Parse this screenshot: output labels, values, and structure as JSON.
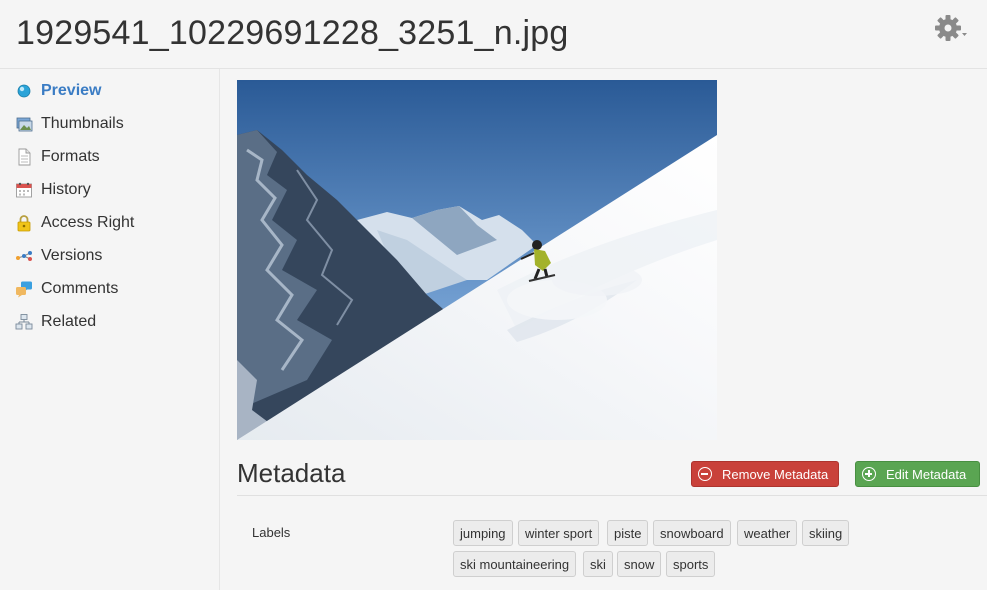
{
  "header": {
    "title": "1929541_10229691228_3251_n.jpg"
  },
  "sidebar": {
    "items": [
      {
        "label": "Preview",
        "icon": "preview-icon",
        "active": true
      },
      {
        "label": "Thumbnails",
        "icon": "thumbnails-icon"
      },
      {
        "label": "Formats",
        "icon": "formats-icon"
      },
      {
        "label": "History",
        "icon": "calendar-icon"
      },
      {
        "label": "Access Right",
        "icon": "lock-icon"
      },
      {
        "label": "Versions",
        "icon": "versions-icon"
      },
      {
        "label": "Comments",
        "icon": "comments-icon"
      },
      {
        "label": "Related",
        "icon": "related-icon"
      }
    ]
  },
  "preview": {
    "image_subject": "ski-photo"
  },
  "metadata": {
    "title": "Metadata",
    "remove_label": "Remove Metadata",
    "edit_label": "Edit Metadata",
    "labels_title": "Labels",
    "tags": [
      "jumping",
      "winter sport",
      "piste",
      "snowboard",
      "weather",
      "skiing",
      "ski mountaineering",
      "ski",
      "snow",
      "sports"
    ]
  },
  "colors": {
    "accent": "#3a7cc4",
    "remove": "#c9413a",
    "edit": "#5aa552"
  }
}
